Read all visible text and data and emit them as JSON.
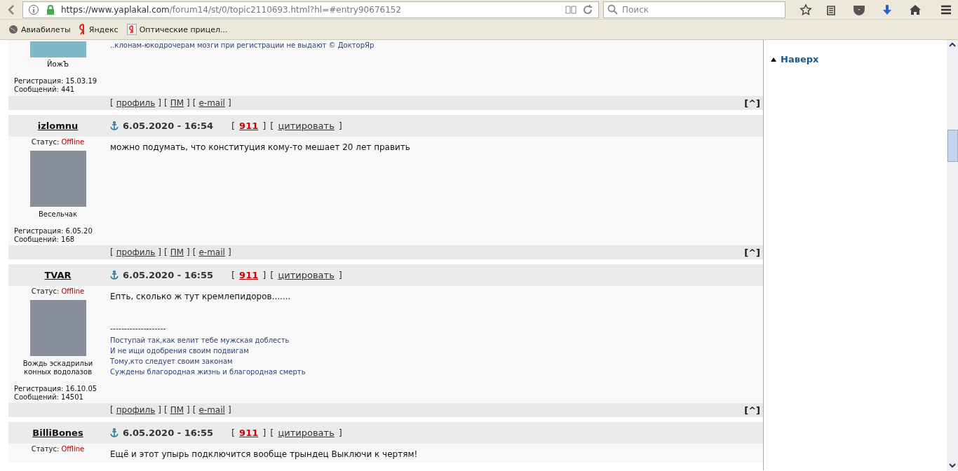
{
  "browser": {
    "url_host": "https://www.yaplakal.com",
    "url_path": "/forum14/st/0/topic2110693.html?hl=#entry90676152",
    "search_placeholder": "Поиск",
    "bookmarks": [
      {
        "kind": "globe",
        "label": "Авиабилеты"
      },
      {
        "kind": "ya",
        "label": "Яндекс"
      },
      {
        "kind": "yabox",
        "label": "Оптические прицел..."
      }
    ]
  },
  "brackets": {
    "open": "[",
    "close": "]"
  },
  "posts": [
    {
      "rank": "ЙожЪ",
      "avatar_partial": true,
      "registration": "Регистрация: 15.03.19",
      "messages": "Сообщений: 441",
      "signature": [
        "..клонам-юкодрочерам мозги при регистрации не выдают © ДокторЯр"
      ],
      "footer_links": [
        "профиль",
        "ПМ",
        "e-mail"
      ],
      "top_link": "[^]"
    },
    {
      "author": "izlomnu",
      "date": "6.05.2020 - 16:54",
      "report": "911",
      "quote": "цитировать",
      "status_label": "Статус:",
      "status": "Offline",
      "rank": "Весельчак",
      "avatar_partial": false,
      "registration": "Регистрация: 6.05.20",
      "messages": "Сообщений: 168",
      "body": [
        "можно подумать, что конституция кому-то мешает 20 лет править"
      ],
      "footer_links": [
        "профиль",
        "ПМ",
        "e-mail"
      ],
      "top_link": "[^]"
    },
    {
      "author": "TVAR",
      "date": "6.05.2020 - 16:55",
      "report": "911",
      "quote": "цитировать",
      "status_label": "Статус:",
      "status": "Offline",
      "rank": "Вождь эскадрильи конных водолазов",
      "avatar_partial": false,
      "registration": "Регистрация: 16.10.05",
      "messages": "Сообщений: 14501",
      "body": [
        "Епть, сколько ж тут кремлепидоров......."
      ],
      "sig_rule": "--------------------",
      "signature": [
        "Поступай так,как велит тебе мужская доблесть",
        "И не ищи одобрения своим подвигам",
        "Тому,кто следует своим законам",
        "Суждены благородная жизнь и благородная смерть"
      ],
      "footer_links": [
        "профиль",
        "ПМ",
        "e-mail"
      ],
      "top_link": "[^]"
    },
    {
      "author": "BilliBones",
      "date": "6.05.2020 - 16:55",
      "report": "911",
      "quote": "цитировать",
      "status_label": "Статус:",
      "status": "Offline",
      "partial": true,
      "body": [
        "Ещё и этот упырь подключится вообще трындец Выключи к чертям!"
      ]
    }
  ],
  "sidebar": {
    "top_link": "Наверх"
  }
}
